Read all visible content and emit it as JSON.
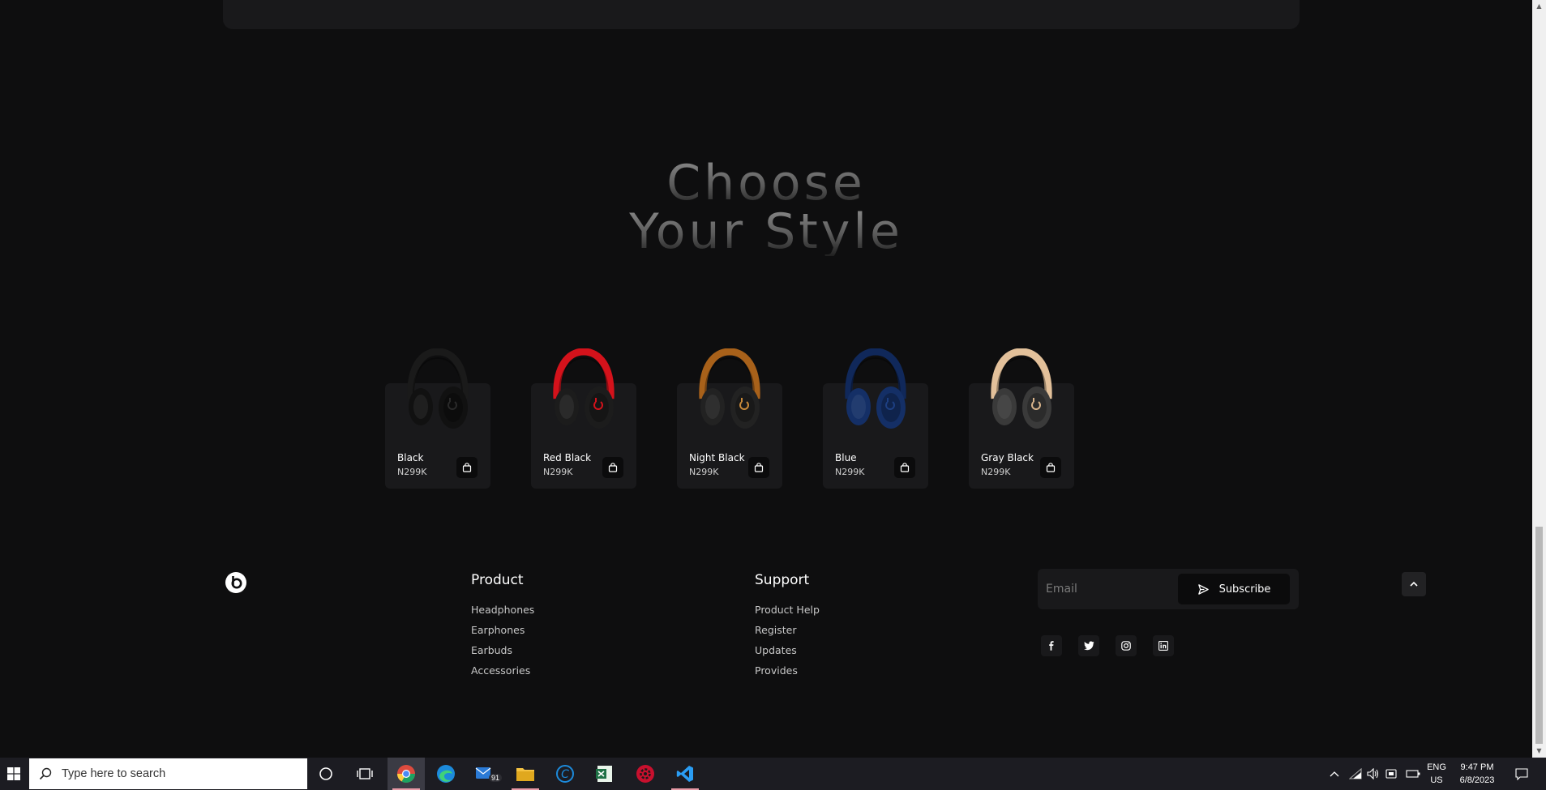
{
  "hero": {
    "line1": "Choose",
    "line2": "Your Style"
  },
  "products": [
    {
      "name": "Black",
      "price": "N299K",
      "band": "#1a1a1a",
      "cup": "#111111",
      "accent": "#2a2a2a"
    },
    {
      "name": "Red Black",
      "price": "N299K",
      "band": "#d4121b",
      "cup": "#1c1c1c",
      "accent": "#d4121b"
    },
    {
      "name": "Night Black",
      "price": "N299K",
      "band": "#a8611a",
      "cup": "#222222",
      "accent": "#c98a3a"
    },
    {
      "name": "Blue",
      "price": "N299K",
      "band": "#10285a",
      "cup": "#142f66",
      "accent": "#1d3f82"
    },
    {
      "name": "Gray Black",
      "price": "N299K",
      "band": "#e2c09a",
      "cup": "#3a3a3a",
      "accent": "#d9b48b"
    }
  ],
  "footer": {
    "product": {
      "title": "Product",
      "links": [
        "Headphones",
        "Earphones",
        "Earbuds",
        "Accessories"
      ]
    },
    "support": {
      "title": "Support",
      "links": [
        "Product Help",
        "Register",
        "Updates",
        "Provides"
      ]
    },
    "email_placeholder": "Email",
    "subscribe_label": "Subscribe",
    "socials": [
      "facebook-icon",
      "twitter-icon",
      "instagram-icon",
      "linkedin-icon"
    ]
  },
  "taskbar": {
    "search_placeholder": "Type here to search",
    "mail_badge": "91",
    "lang": "ENG",
    "region": "US",
    "time": "9:47 PM",
    "date": "6/8/2023"
  }
}
